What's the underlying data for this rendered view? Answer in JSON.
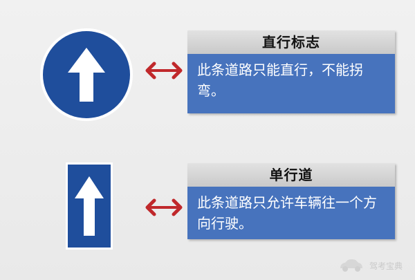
{
  "items": [
    {
      "title": "直行标志",
      "description": "此条道路只能直行，不能拐弯。",
      "sign_shape": "circle",
      "sign_icon": "straight-arrow-icon"
    },
    {
      "title": "单行道",
      "description": "此条道路只允许车辆往一个方向行驶。",
      "sign_shape": "rectangle",
      "sign_icon": "one-way-arrow-icon"
    }
  ],
  "connector_icon": "double-arrow-icon",
  "watermark": "驾考宝典",
  "colors": {
    "sign_blue": "#1f4e9c",
    "card_blue": "#4773bd",
    "card_header_gray": "#d4d4d4",
    "connector_red": "#c0282b",
    "background": "#ededed"
  }
}
